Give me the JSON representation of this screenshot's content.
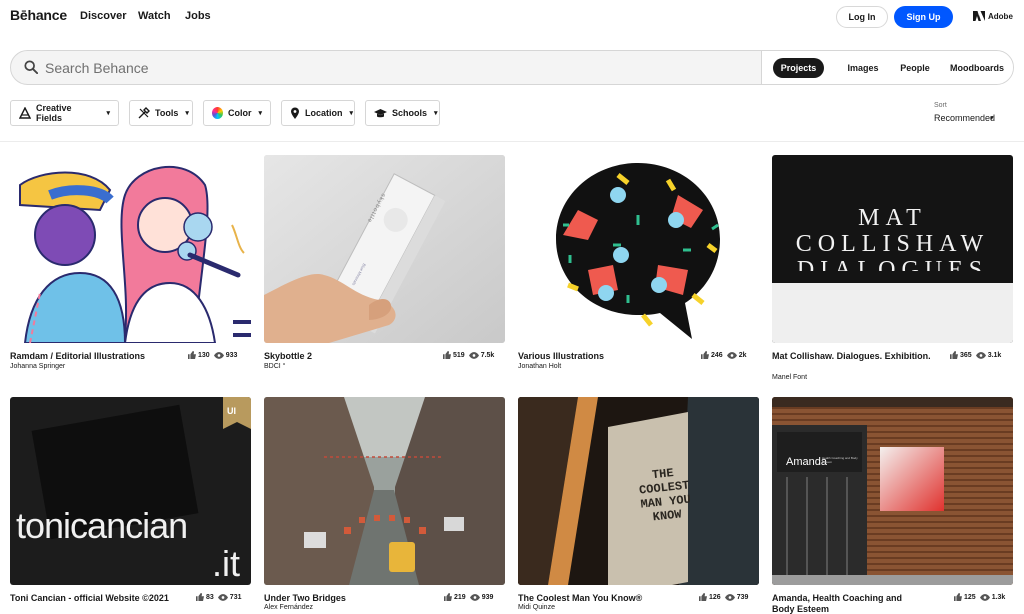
{
  "nav": {
    "logo": "Bēhance",
    "links": [
      "Discover",
      "Watch",
      "Jobs"
    ],
    "login": "Log In",
    "signup": "Sign Up",
    "adobe": "Adobe"
  },
  "search": {
    "placeholder": "Search Behance",
    "scopes": [
      "Projects",
      "Images",
      "People",
      "Moodboards"
    ],
    "active_scope": "Projects"
  },
  "filters": [
    "Creative Fields",
    "Tools",
    "Color",
    "Location",
    "Schools"
  ],
  "sort": {
    "label": "Sort",
    "value": "Recommended"
  },
  "colors": {
    "accent": "#0057ff",
    "text": "#191919"
  },
  "projects": [
    {
      "title": "Ramdam / Editorial Illustrations",
      "owner": "Johanna Springer",
      "likes": "130",
      "views": "933"
    },
    {
      "title": "Skybottle 2",
      "owner": "BDCI °",
      "likes": "519",
      "views": "7.5k"
    },
    {
      "title": "Various Illustrations",
      "owner": "Jonathan Holt",
      "likes": "246",
      "views": "2k"
    },
    {
      "title": "Mat Collishaw. Dialogues. Exhibition.",
      "owner": "Manel Font",
      "likes": "365",
      "views": "3.1k"
    },
    {
      "title": "Toni Cancian - official Website ©2021",
      "owner": "",
      "likes": "83",
      "views": "731"
    },
    {
      "title": "Under Two Bridges",
      "owner": "Alex Fernández",
      "likes": "219",
      "views": "939"
    },
    {
      "title": "The Coolest Man You Know®",
      "owner": "Midi Quinze",
      "likes": "126",
      "views": "739"
    },
    {
      "title": "Amanda, Health Coaching and Body Esteem",
      "owner": "",
      "likes": "125",
      "views": "1.3k"
    }
  ],
  "thumb_text": {
    "skybottle_label": "skybottle",
    "skybottle_small": "Blue Minerals",
    "mat_line1": "MAT",
    "mat_line2": "COLLISHAW",
    "mat_line3": "DIALOGUES",
    "toni_badge": "UI",
    "toni_line1": "tonicancian",
    "toni_line2": ".it",
    "coolest": "THE COOLEST MAN YOU KNOW",
    "amanda": "Amanda",
    "amanda_sub": "Health Coaching and Body Esteem"
  }
}
